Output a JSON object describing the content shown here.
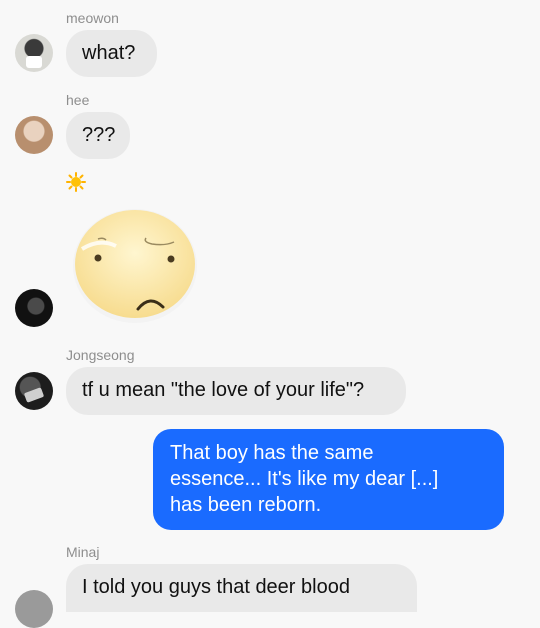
{
  "messages": [
    {
      "sender": "meowon",
      "text": "what?",
      "avatar": "user-avatar-meowon"
    },
    {
      "sender": "hee",
      "text": "???",
      "avatar": "user-avatar-hee"
    },
    {
      "sender": "",
      "sticker": "sad-face-sticker",
      "reaction": "sun-emoji",
      "avatar": "user-avatar-dark"
    },
    {
      "sender": "Jongseong",
      "text": "tf u mean \"the love of your life\"?",
      "avatar": "user-avatar-jongseong"
    },
    {
      "sender": "me",
      "lines": [
        "That boy has the same",
        "essence... It's like my dear [...]",
        "has been reborn."
      ]
    },
    {
      "sender": "Minaj",
      "text": "I told you guys that deer blood",
      "avatar": "user-avatar-minaj"
    }
  ],
  "colors": {
    "outgoing_bubble": "#1a6bff",
    "incoming_bubble": "#e9e9e9",
    "background": "#f8f8f8"
  }
}
